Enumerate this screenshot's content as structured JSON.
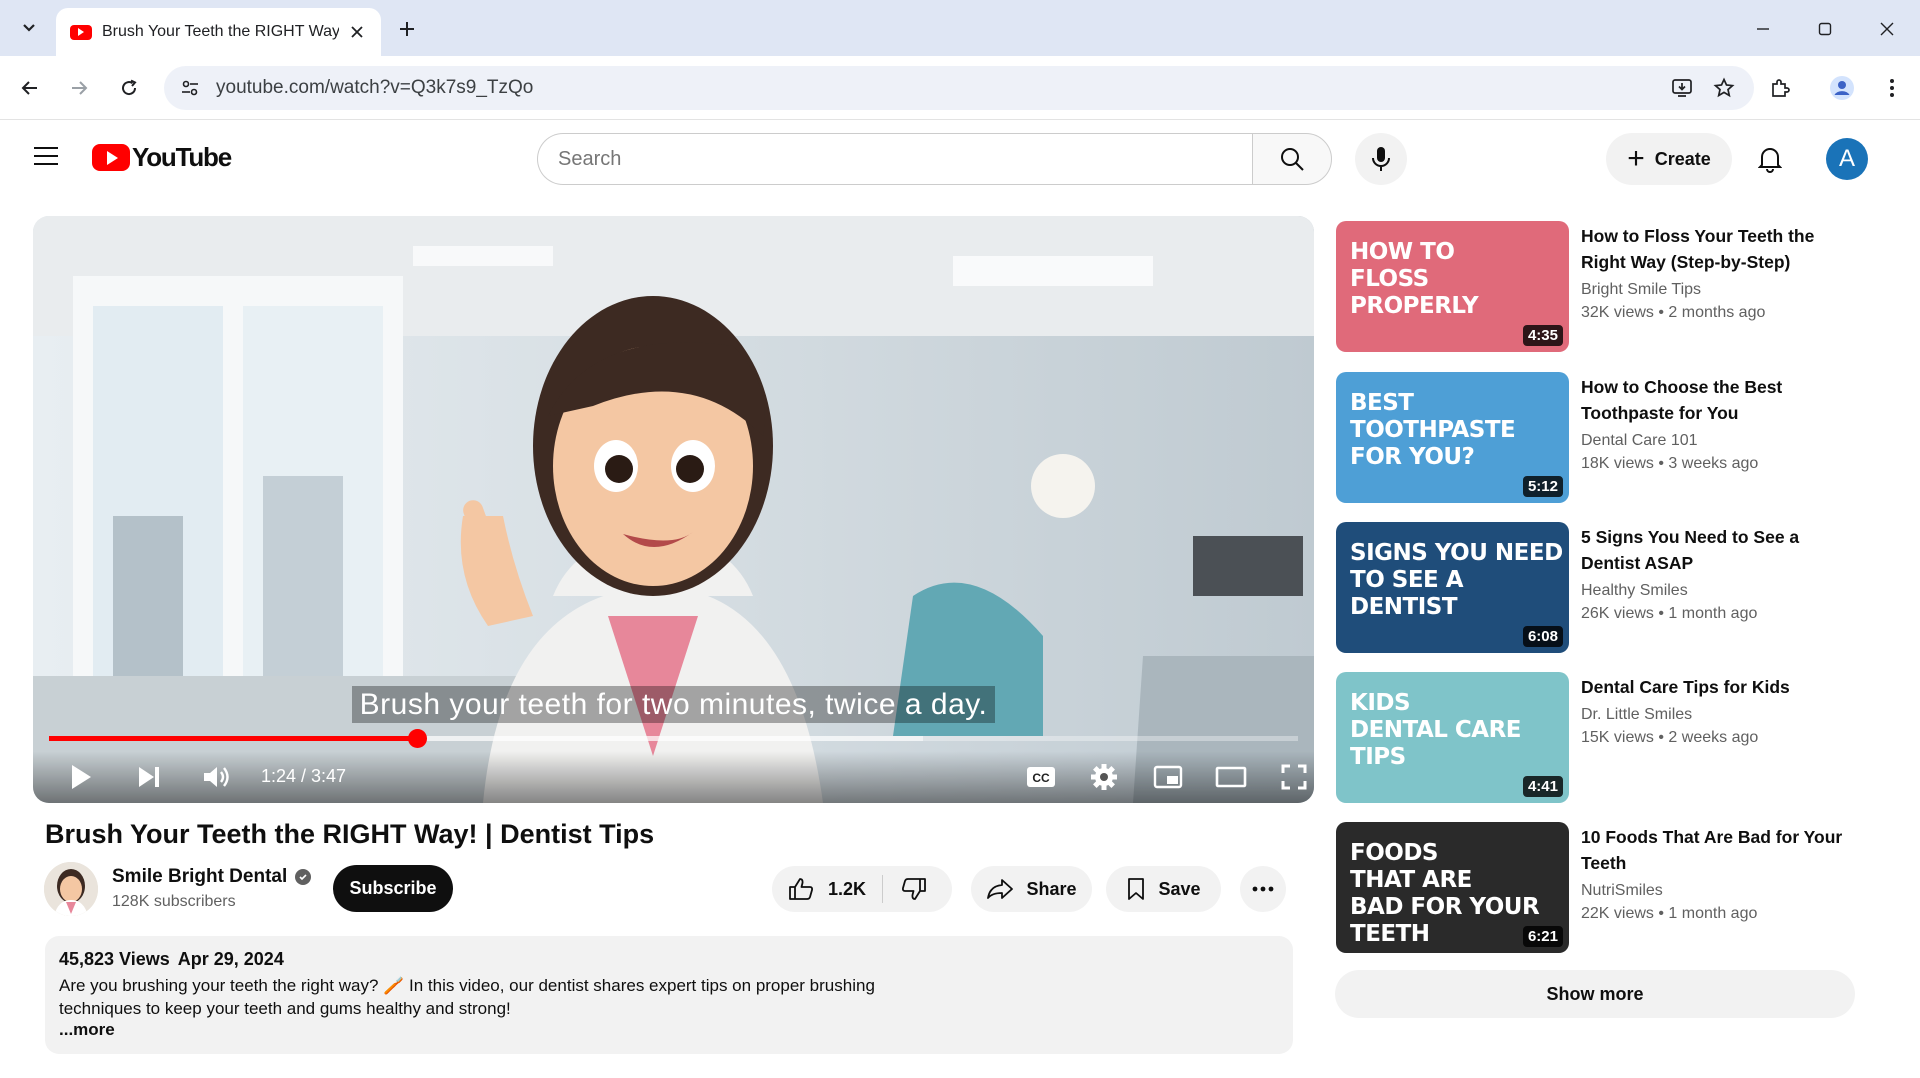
{
  "browser": {
    "tab_title": "Brush Your Teeth the RIGHT Way",
    "url": "youtube.com/watch?v=Q3k7s9_TzQo"
  },
  "header": {
    "logo_text": "YouTube",
    "search_placeholder": "Search",
    "create_label": "Create",
    "avatar_letter": "A"
  },
  "player": {
    "caption": "Brush your teeth for two minutes, twice a day.",
    "time": "1:24 / 3:47",
    "played_fraction": 0.295,
    "buffered_fraction": 0.7,
    "cc_label": "CC"
  },
  "video": {
    "title": "Brush Your Teeth the RIGHT Way! | Dentist Tips",
    "channel": "Smile Bright Dental",
    "subscribers": "128K subscribers",
    "subscribe_label": "Subscribe",
    "likes": "1.2K",
    "share_label": "Share",
    "save_label": "Save",
    "views": "45,823 Views",
    "date": "Apr 29, 2024",
    "description": "Are you brushing your teeth the right way? 🪥 In this video, our dentist shares expert tips on proper brushing techniques to keep your teeth and gums healthy and strong!",
    "more_label": "...more"
  },
  "recommendations": [
    {
      "thumb_lines": [
        "How to",
        "Floss",
        "Properly"
      ],
      "duration": "4:35",
      "title": "How to Floss Your Teeth the Right Way (Step-by-Step)",
      "channel": "Bright Smile Tips",
      "views": "32K views",
      "age": "2 months ago",
      "color": "#e06a7a"
    },
    {
      "thumb_lines": [
        "Best",
        "Toothpaste",
        "For You?"
      ],
      "duration": "5:12",
      "title": "How to Choose the Best Toothpaste for You",
      "channel": "Dental Care 101",
      "views": "18K views",
      "age": "3 weeks ago",
      "color": "#4e9fd6"
    },
    {
      "thumb_lines": [
        "Signs You Need",
        "To See A",
        "Dentist"
      ],
      "duration": "6:08",
      "title": "5 Signs You Need to See a Dentist ASAP",
      "channel": "Healthy Smiles",
      "views": "26K views",
      "age": "1 month ago",
      "color": "#1f4d7a"
    },
    {
      "thumb_lines": [
        "Kids",
        "Dental Care",
        "Tips"
      ],
      "duration": "4:41",
      "title": "Dental Care Tips for Kids",
      "channel": "Dr. Little Smiles",
      "views": "15K views",
      "age": "2 weeks ago",
      "color": "#7fc4c9"
    },
    {
      "thumb_lines": [
        "Foods",
        "That Are",
        "Bad For Your",
        "Teeth"
      ],
      "duration": "6:21",
      "title": "10 Foods That Are Bad for Your Teeth",
      "channel": "NutriSmiles",
      "views": "22K views",
      "age": "1 month ago",
      "color": "#2a2a2a"
    }
  ],
  "show_more_label": "Show more"
}
